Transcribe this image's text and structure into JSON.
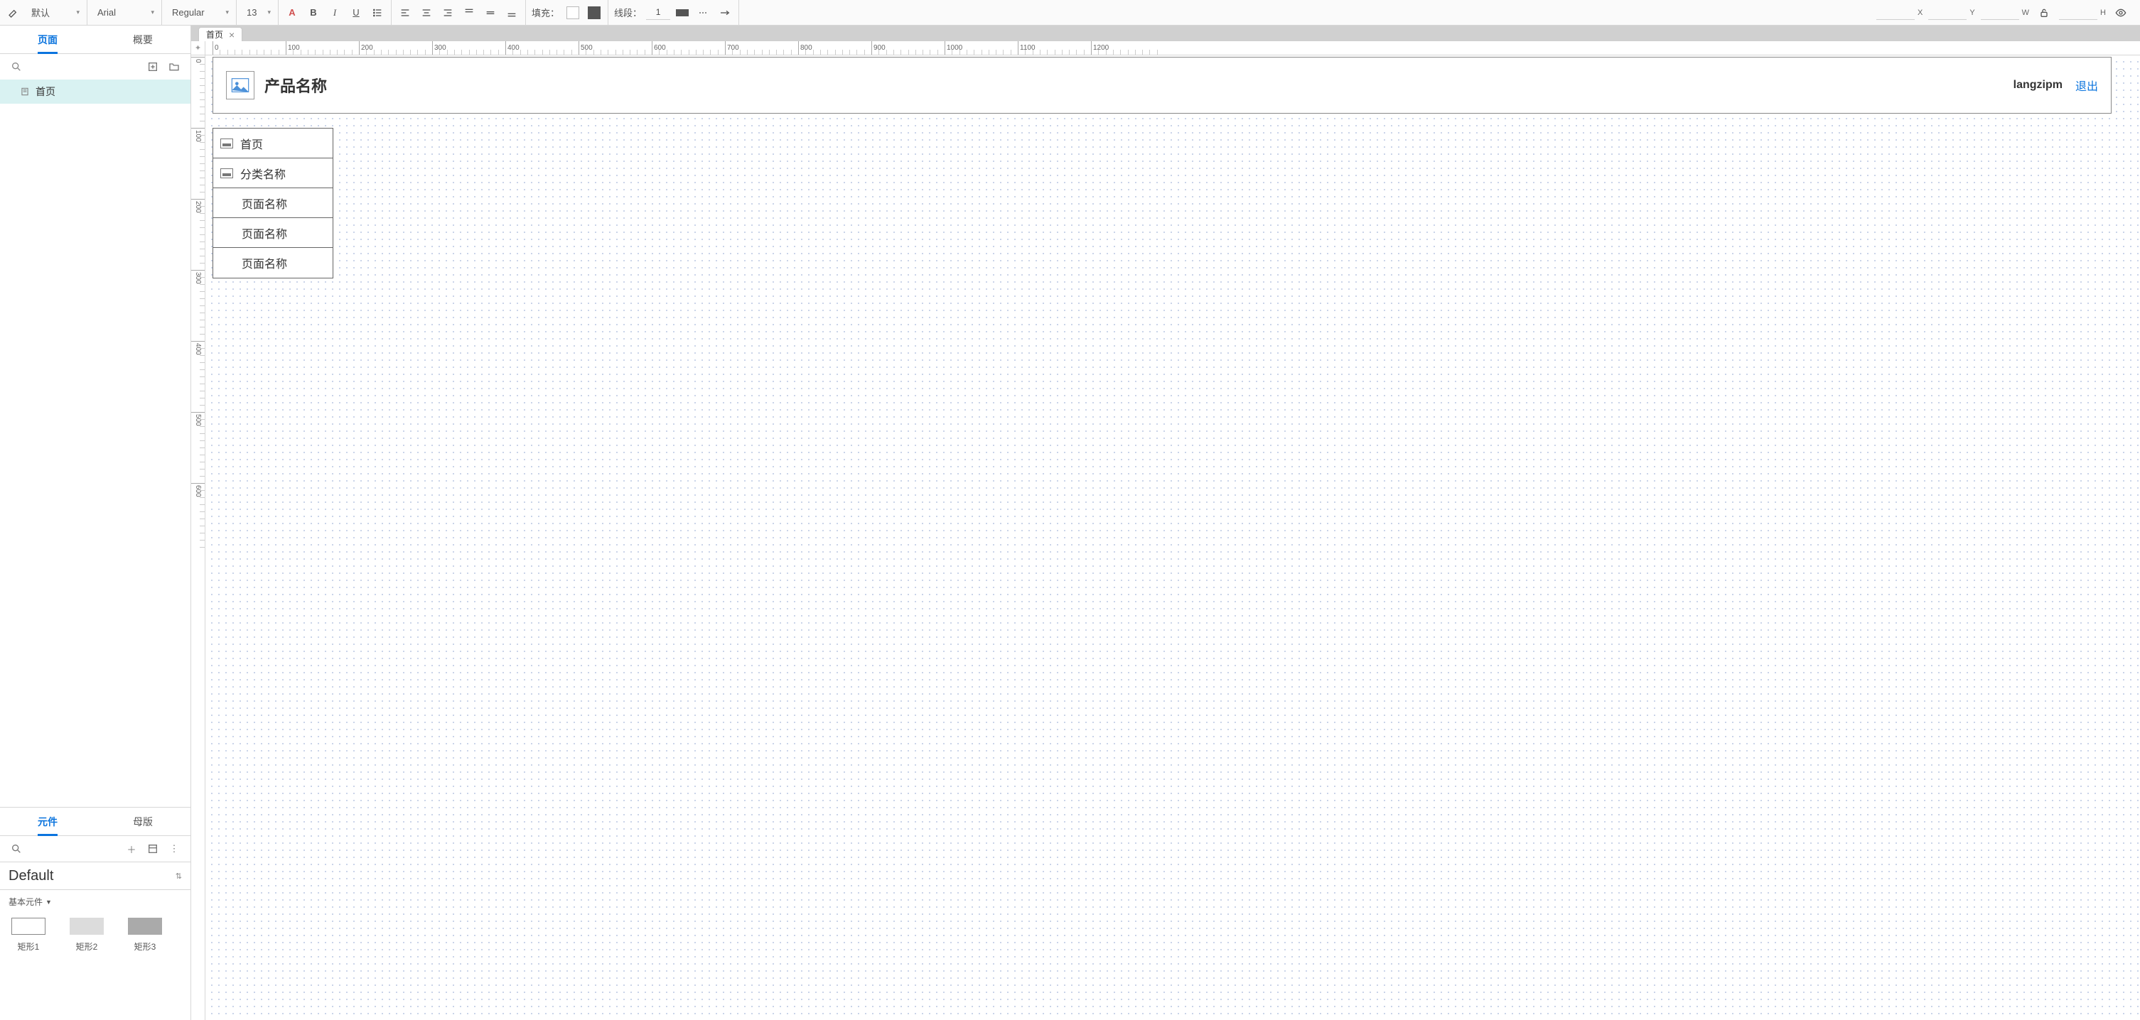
{
  "toolbar": {
    "style_select": "默认",
    "font_family": "Arial",
    "font_weight": "Regular",
    "font_size": "13",
    "fill_label": "填充：",
    "line_label": "线段：",
    "line_width": "1",
    "dims": {
      "x_label": "X",
      "y_label": "Y",
      "w_label": "W",
      "h_label": "H"
    }
  },
  "left": {
    "tabs": {
      "pages": "页面",
      "outline": "概要"
    },
    "pages": [
      "首页"
    ],
    "widgets_tabs": {
      "widgets": "元件",
      "masters": "母版"
    },
    "library_name": "Default",
    "section_title": "基本元件",
    "shapes": [
      "矩形1",
      "矩形2",
      "矩形3"
    ]
  },
  "doc_tabs": [
    "首页"
  ],
  "canvas": {
    "ruler_marks_h": [
      0,
      100,
      200,
      300,
      400,
      500,
      600,
      700,
      800,
      900,
      1000,
      1100,
      1200
    ],
    "ruler_marks_v": [
      0,
      100,
      200,
      300,
      400,
      500,
      600
    ],
    "header": {
      "title": "产品名称",
      "user": "langzipm",
      "logout": "退出"
    },
    "menu": {
      "home": "首页",
      "category": "分类名称",
      "pages": [
        "页面名称",
        "页面名称",
        "页面名称"
      ]
    }
  }
}
